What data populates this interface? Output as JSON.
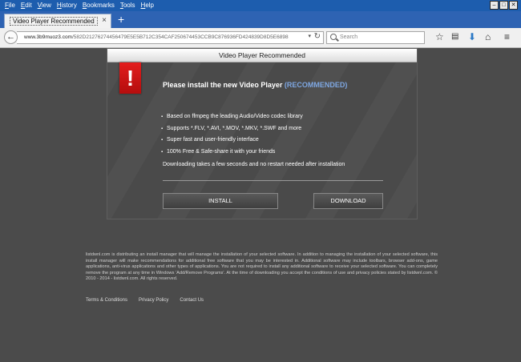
{
  "menu": [
    "File",
    "Edit",
    "View",
    "History",
    "Bookmarks",
    "Tools",
    "Help"
  ],
  "window_controls": [
    "–",
    "□",
    "✕"
  ],
  "tab": {
    "title": "Video Player Recommended",
    "close": "×",
    "new_tab": "+"
  },
  "address": {
    "host": "www.3b9muoz3.com",
    "path": "/582D21276274456479E5E5B712C354CAF250674453CCB9C876936FD424839D8D5E6898",
    "back_icon": "arrow-left-icon",
    "dropdown": "▾",
    "reload": "↻"
  },
  "search": {
    "placeholder": "Search"
  },
  "toolbar_icons": [
    "star-icon",
    "reading-list-icon",
    "download-icon",
    "home-icon",
    "menu-icon"
  ],
  "dialog": {
    "title": "Video Player Recommended",
    "badge": "!",
    "headline": "Please install the new Video Player",
    "headline_tag": "(RECOMMENDED)",
    "features": [
      "Based on ffmpeg the leading Audio/Video codec library",
      "Supports *.FLV, *.AVI, *.MOV, *.MKV, *.SWF and more",
      "Super fast and user-friendly interface",
      "100% Free & Safe-share it with your friends"
    ],
    "note": "Downloading takes a few seconds and no restart needed after installation",
    "install_label": "INSTALL",
    "download_label": "DOWNLOAD"
  },
  "footer": {
    "disclaimer": "listdwnl.com is distributing an install manager that will manage the installation of your selected software. In addition to managing the installation of your selected software, this install manager will make recommendations for additional free software that you may be interested in. Additional software may include toolbars, browser add-ons, game applications, anti-virus applications and other types of applications. You are not required to install any additional software to receive your selected software. You can completely remove the program at any time in Windows 'Add/Remove Programs'. At the time of downloading you accept the conditions of use and privacy policies stated by listdwnl.com. © 2010 - 2014 - listdwnl.com. All rights reserved.",
    "links": [
      "Terms & Conditions",
      "Privacy Policy",
      "Contact Us"
    ]
  },
  "colors": {
    "titlebar": "#1d5dae",
    "accent": "#7ea7e2",
    "alert": "#d81818",
    "page_bg": "#4b4b4b"
  }
}
